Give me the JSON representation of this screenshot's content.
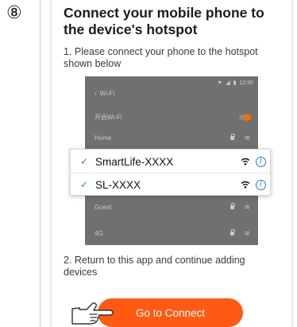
{
  "step": {
    "number": "⑧"
  },
  "title": "Connect your mobile phone to the device's hotspot",
  "instructions": {
    "step1": "1. Please connect your phone to the hotspot shown below",
    "step2": "2. Return to this app and continue adding devices"
  },
  "phone": {
    "status_time": "12:30",
    "header": "Wi-Fi",
    "toggle_label": "开启Wi-Fi",
    "networks_background": [
      "Home",
      "Guest",
      "4G"
    ]
  },
  "popup": {
    "networks": [
      {
        "name": "SmartLife-XXXX",
        "connected": true
      },
      {
        "name": "SL-XXXX",
        "connected": true
      }
    ]
  },
  "connect_button": {
    "label": "Go to Connect"
  },
  "colors": {
    "accent": "#ff5a14",
    "check": "#1e7fd6",
    "toggle_on": "#ff6a00"
  },
  "icons": [
    "hand-pointer-icon",
    "wifi-icon",
    "info-icon",
    "checkmark-icon",
    "lock-icon"
  ]
}
